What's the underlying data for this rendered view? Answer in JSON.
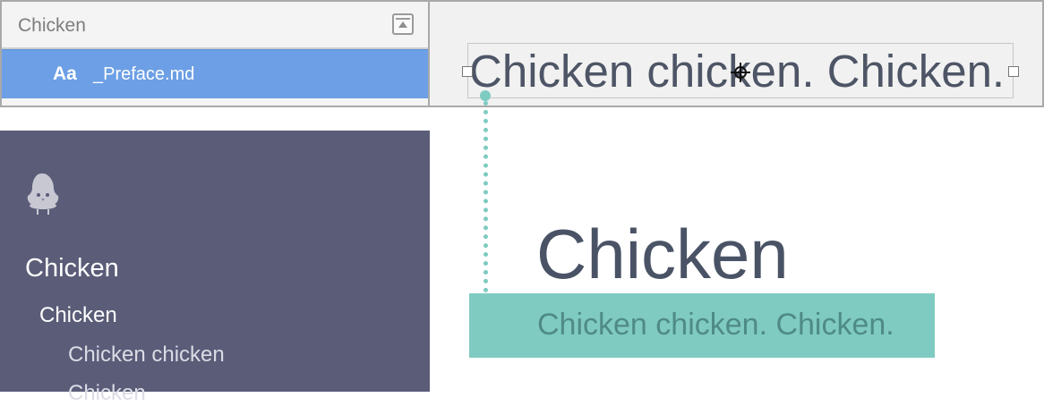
{
  "file_panel": {
    "title": "Chicken",
    "collapse_icon": "collapse-panel-icon",
    "file": {
      "icon": "Aa",
      "name": "_Preface.md"
    }
  },
  "preview": {
    "selected_text": "Chicken chicken. Chicken.",
    "cursor_icon": "crosshair-icon"
  },
  "sidebar": {
    "logo_icon": "chick-logo-icon",
    "title": "Chicken",
    "subtitle": "Chicken",
    "items": [
      "Chicken chicken",
      "Chicken"
    ]
  },
  "main": {
    "heading": "Chicken",
    "highlighted": "Chicken chicken. Chicken."
  },
  "colors": {
    "selection_blue": "#6c9fe5",
    "sidebar_bg": "#5a5c78",
    "teal_accent": "#80cbc1",
    "text_dark": "#4a5366"
  }
}
